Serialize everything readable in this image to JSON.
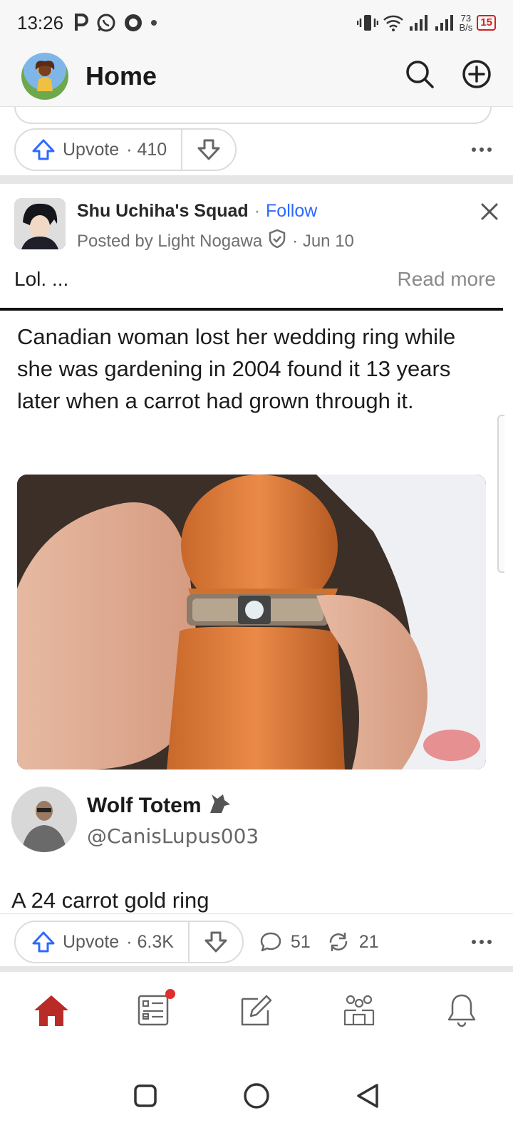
{
  "status_bar": {
    "time": "13:26",
    "net_speed_value": "73",
    "net_speed_unit": "B/s",
    "battery": "15"
  },
  "header": {
    "title": "Home"
  },
  "previous_post": {
    "upvote_label": "Upvote",
    "upvote_count": "· 410"
  },
  "post": {
    "space_name": "Shu Uchiha's Squad",
    "separator": "·",
    "follow_label": "Follow",
    "posted_by": "Posted by Light Nogawa",
    "date": "· Jun 10",
    "excerpt": "Lol. ...",
    "read_more": "Read more",
    "image": {
      "tweet_text": "Canadian woman lost her wedding ring while she was gardening in 2004 found it 13 years later when a carrot had grown through it.",
      "author_name": "Wolf Totem",
      "author_handle": "@CanisLupus003",
      "reply_text": "A 24 carrot gold ring"
    },
    "upvote_label": "Upvote",
    "upvote_count": "· 6.3K",
    "comments": "51",
    "shares": "21"
  },
  "colors": {
    "accent_red": "#b92b27",
    "link_blue": "#2e69ff",
    "upvote_blue": "#2e69ff"
  },
  "bottom_nav": {
    "items": [
      "home-icon",
      "following-icon",
      "answer-icon",
      "spaces-icon",
      "notifications-icon"
    ]
  }
}
